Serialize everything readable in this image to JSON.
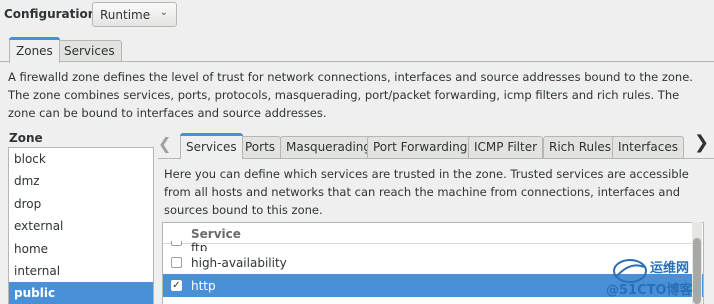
{
  "config": {
    "label": "Configuration:",
    "value": "Runtime"
  },
  "top_tabs": [
    {
      "label": "Zones"
    },
    {
      "label": "Services"
    }
  ],
  "zones_description": "A firewalld zone defines the level of trust for network connections, interfaces and source addresses bound to the zone. The zone combines services, ports, protocols, masquerading, port/packet forwarding, icmp filters and rich rules. The zone can be bound to interfaces and source addresses.",
  "zone_list": {
    "title": "Zone",
    "items": [
      "block",
      "dmz",
      "drop",
      "external",
      "home",
      "internal",
      "public"
    ],
    "selected": "public"
  },
  "inner_tabs": [
    {
      "label": "Services"
    },
    {
      "label": "Ports"
    },
    {
      "label": "Masquerading"
    },
    {
      "label": "Port Forwarding"
    },
    {
      "label": "ICMP Filter"
    },
    {
      "label": "Rich Rules"
    },
    {
      "label": "Interfaces"
    }
  ],
  "services_description": "Here you can define which services are trusted in the zone. Trusted services are accessible from all hosts and networks that can reach the machine from connections, interfaces and sources bound to this zone.",
  "services_table": {
    "header": "Service",
    "rows": [
      {
        "name": "ftp",
        "checked": false
      },
      {
        "name": "high-availability",
        "checked": false
      },
      {
        "name": "http",
        "checked": true
      }
    ]
  },
  "watermark": {
    "line1": "运维网",
    "line2": "@51CTO博客"
  },
  "colors": {
    "accent": "#4a90d9",
    "window_bg": "#efefef"
  }
}
